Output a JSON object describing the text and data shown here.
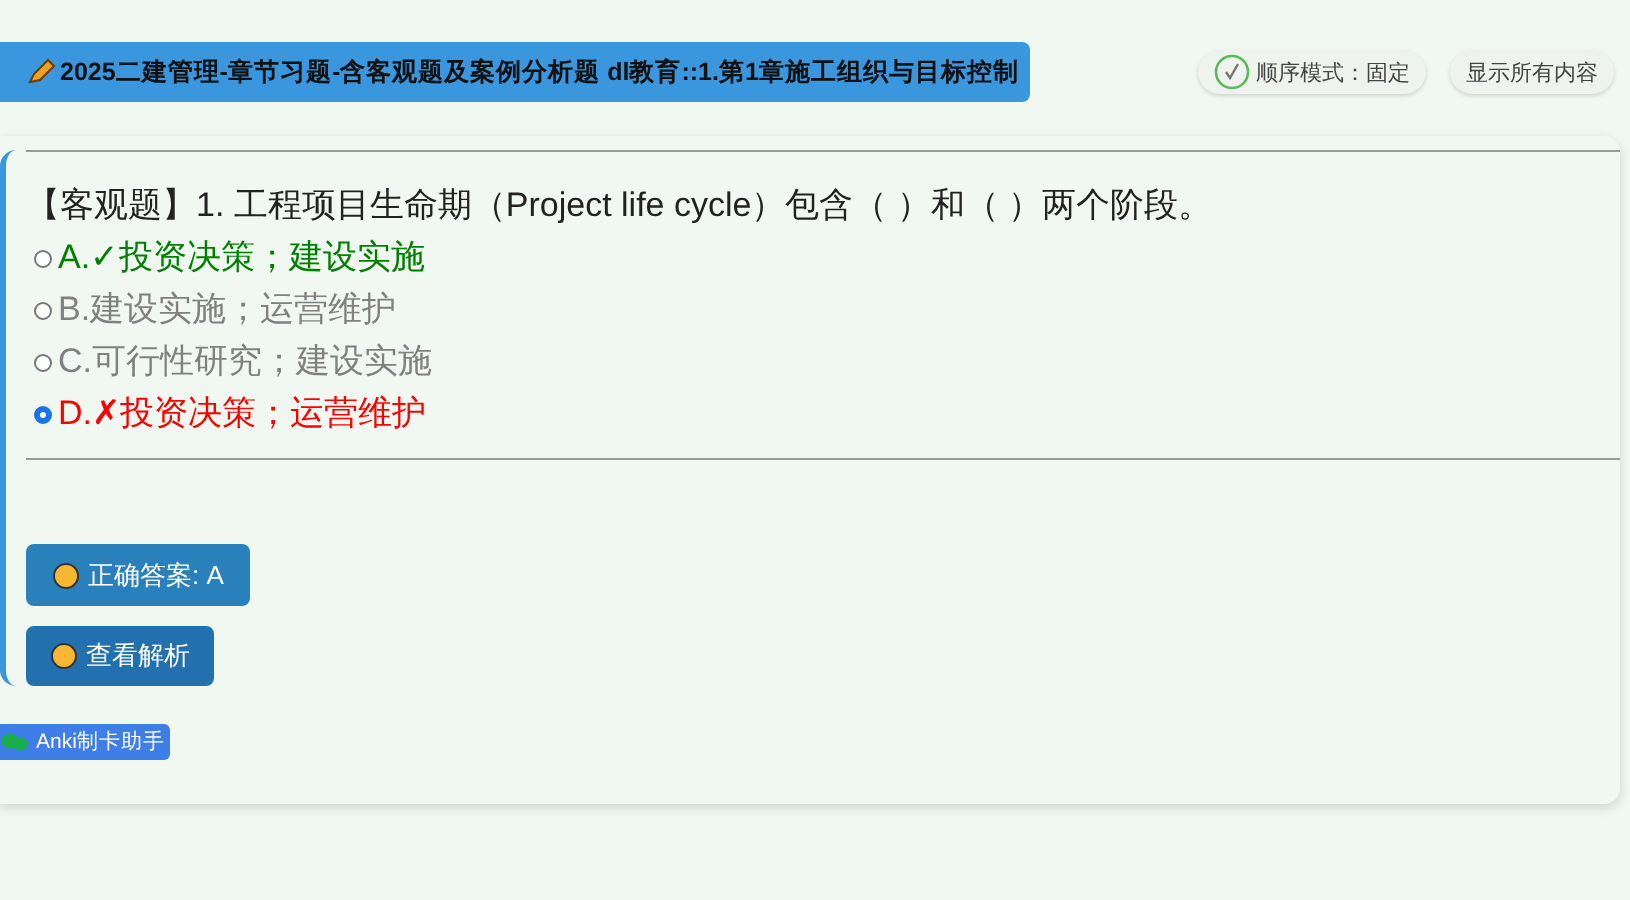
{
  "header": {
    "deck_title": "2025二建管理-章节习题-含客观题及案例分析题 dl教育::1.第1章施工组织与目标控制",
    "order_mode": "顺序模式：固定",
    "show_all": "显示所有内容"
  },
  "question": {
    "text": "【客观题】1. 工程项目生命期（Project life cycle）包含（ ）和（ ）两个阶段。",
    "options": [
      {
        "label": "A.✓投资决策；建设实施",
        "kind": "correct",
        "selected": false
      },
      {
        "label": "B.建设实施；运营维护",
        "kind": "neutral",
        "selected": false
      },
      {
        "label": "C.可行性研究；建设实施",
        "kind": "neutral",
        "selected": false
      },
      {
        "label": "D.✗投资决策；运营维护",
        "kind": "wrong",
        "selected": true
      }
    ]
  },
  "buttons": {
    "answer": "正确答案: A",
    "analysis": "查看解析"
  },
  "footer": {
    "badge": "Anki制卡助手"
  }
}
